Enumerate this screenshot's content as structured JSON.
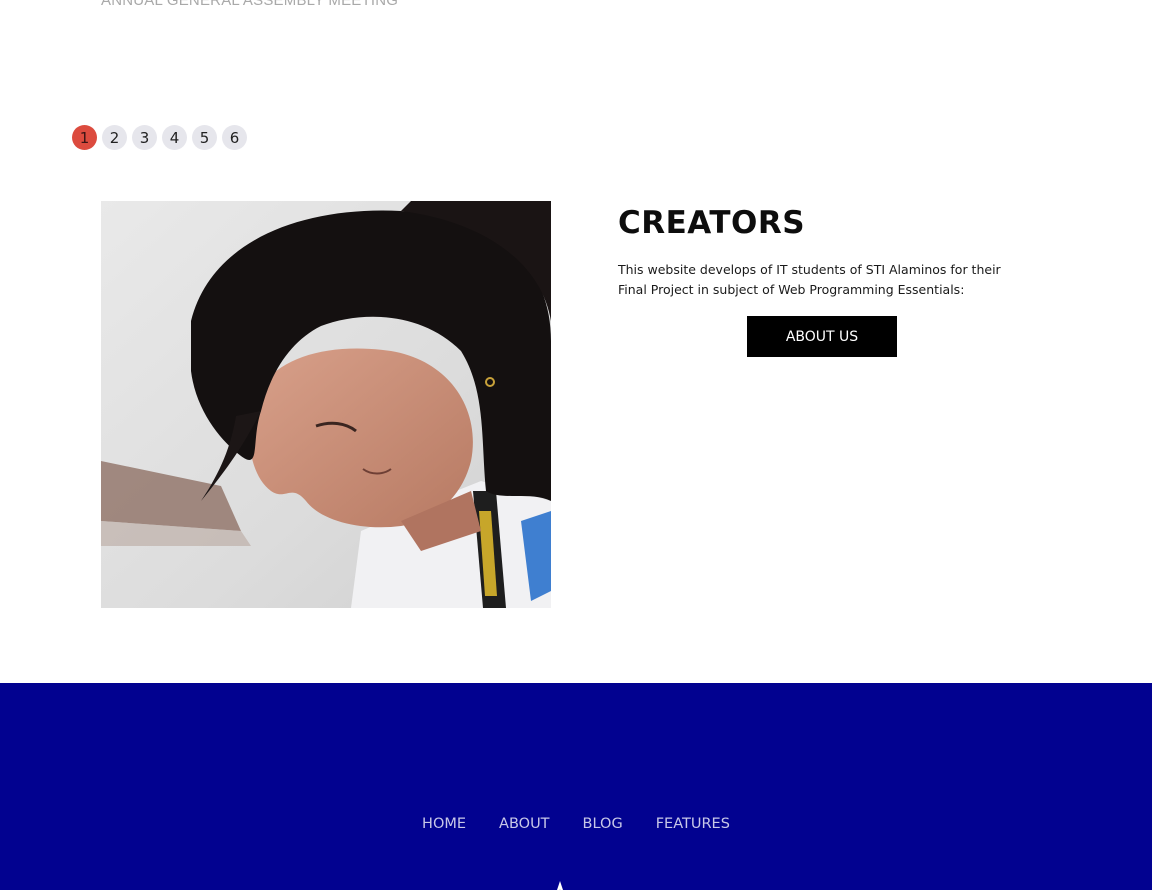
{
  "header": {
    "caption": "ANNUAL GENERAL ASSEMBLY MEETING"
  },
  "pagination": {
    "pages": [
      "1",
      "2",
      "3",
      "4",
      "5",
      "6"
    ],
    "active": "1"
  },
  "creators": {
    "title": "CREATORS",
    "description": "This website develops of IT students of STI Alaminos for their Final Project in subject of Web Programming Essentials:",
    "button_label": "ABOUT US",
    "photo_icon": "portrait-photo"
  },
  "footer": {
    "nav": [
      "HOME",
      "ABOUT",
      "BLOG",
      "FEATURES"
    ],
    "background_color": "#020290",
    "logo_icon": "logo-icon"
  },
  "colors": {
    "active_page": "#dc4b3e",
    "button_bg": "#000000",
    "footer_bg": "#020290"
  }
}
